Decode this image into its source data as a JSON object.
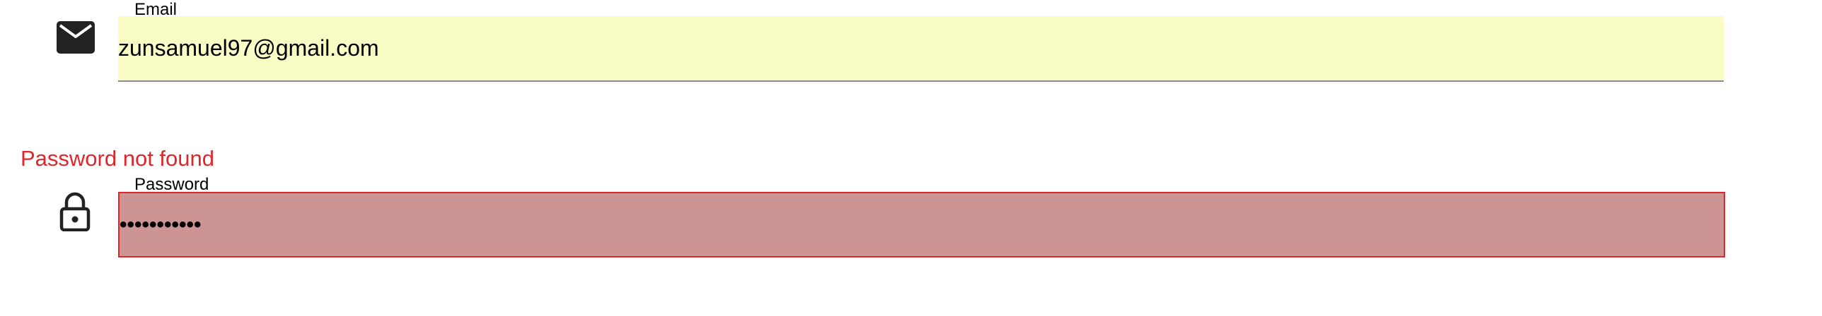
{
  "form": {
    "email": {
      "label": "Email",
      "value": "zunsamuel97@gmail.com",
      "icon": "envelope-icon",
      "background": "#fafcc5"
    },
    "password": {
      "label": "Password",
      "value": "•••••••••••",
      "icon": "lock-icon",
      "background": "#cc9593",
      "border_color": "#e0262a"
    },
    "error": {
      "message": "Password not found",
      "color": "#e0262a"
    }
  }
}
